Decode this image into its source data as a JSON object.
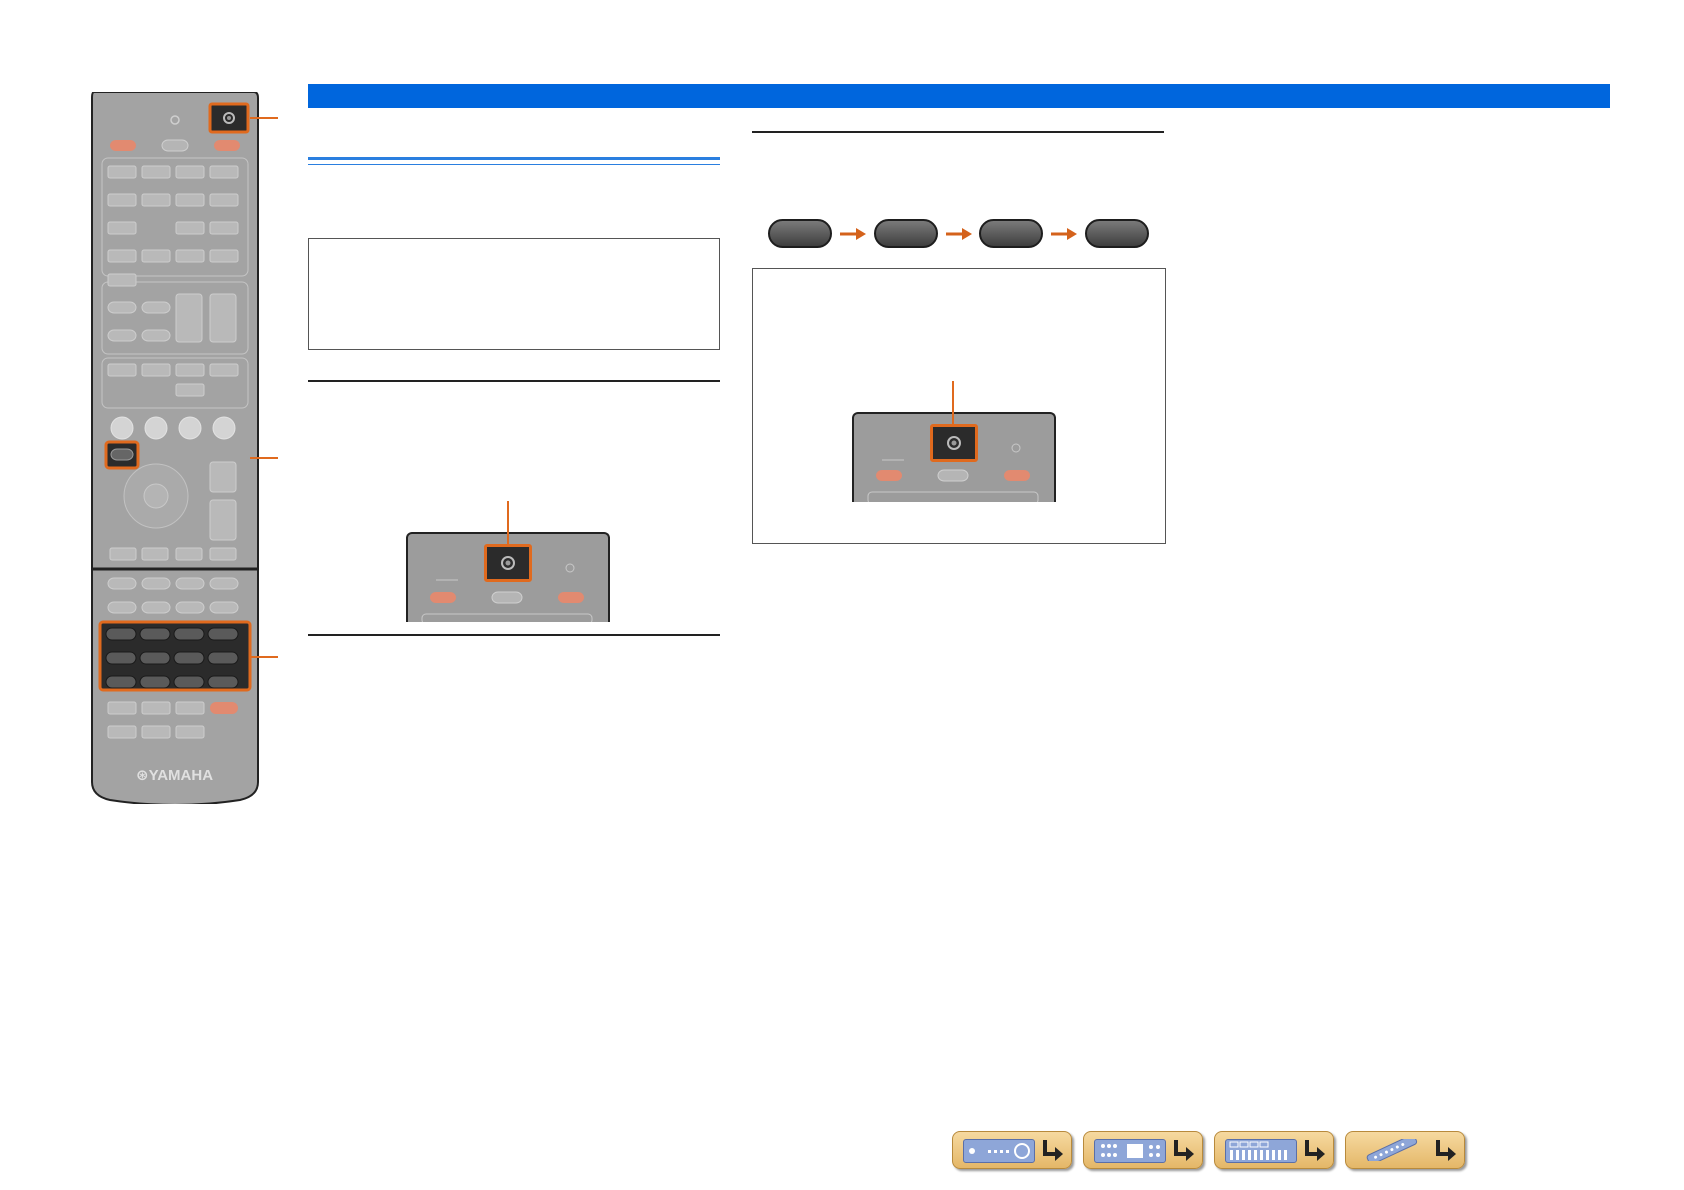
{
  "page": {
    "background": "#ffffff"
  },
  "colors": {
    "header_bar": "#0066dd",
    "highlight": "#e06a1e",
    "remote_body": "#9c9c9c",
    "nav_button": "#e4b768"
  },
  "remote": {
    "brand": "⊛YAMAHA",
    "icons": [
      "remote-control-icon"
    ]
  },
  "diagram": {
    "sequence_button_count": 4
  },
  "footer_nav": {
    "buttons": [
      {
        "icon": "front-panel-icon"
      },
      {
        "icon": "rear-panel-icon"
      },
      {
        "icon": "on-screen-menu-icon"
      },
      {
        "icon": "remote-control-icon"
      }
    ]
  }
}
